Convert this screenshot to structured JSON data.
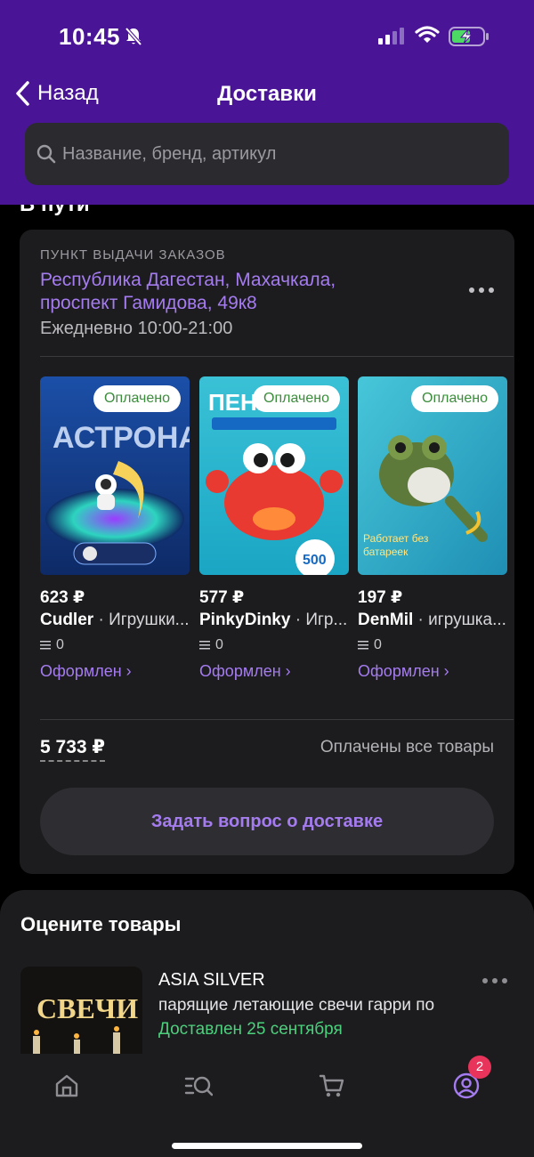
{
  "status_bar": {
    "time": "10:45"
  },
  "nav": {
    "back_label": "Назад",
    "title": "Доставки"
  },
  "search": {
    "placeholder": "Название, бренд, артикул"
  },
  "section": {
    "heading": "В пути"
  },
  "pickup": {
    "caption": "ПУНКТ ВЫДАЧИ ЗАКАЗОВ",
    "address": "Республика Дагестан, Махачкала, проспект Гамидова, 49к8",
    "hours": "Ежедневно 10:00-21:00"
  },
  "products": [
    {
      "badge": "Оплачено",
      "price": "623 ₽",
      "brand": "Cudler",
      "separator": " · ",
      "category": "Игрушки...",
      "count": "0",
      "status": "Оформлен ›"
    },
    {
      "badge": "Оплачено",
      "price": "577 ₽",
      "brand": "PinkyDinky",
      "separator": " · ",
      "category": "Игр...",
      "count": "0",
      "status": "Оформлен ›"
    },
    {
      "badge": "Оплачено",
      "price": "197 ₽",
      "brand": "DenMil",
      "separator": " · ",
      "category": "игрушка...",
      "count": "0",
      "status": "Оформлен ›"
    }
  ],
  "total": {
    "amount": "5 733 ₽",
    "status": "Оплачены все товары"
  },
  "ask_button": {
    "label": "Задать вопрос о доставке"
  },
  "rate": {
    "title": "Оцените товары",
    "item": {
      "brand": "ASIA SILVER",
      "name": "парящие летающие свечи гарри по",
      "delivered": "Доставлен 25 сентября"
    }
  },
  "tab_bar": {
    "tabs": [
      "home-icon",
      "catalog-search-icon",
      "cart-icon",
      "profile-icon"
    ],
    "profile_badge": "2"
  },
  "colors": {
    "header": "#4a1496",
    "accent": "#a57cf0",
    "paid": "#3b8c3b",
    "delivered": "#4cd07d",
    "badge": "#e8345a"
  }
}
